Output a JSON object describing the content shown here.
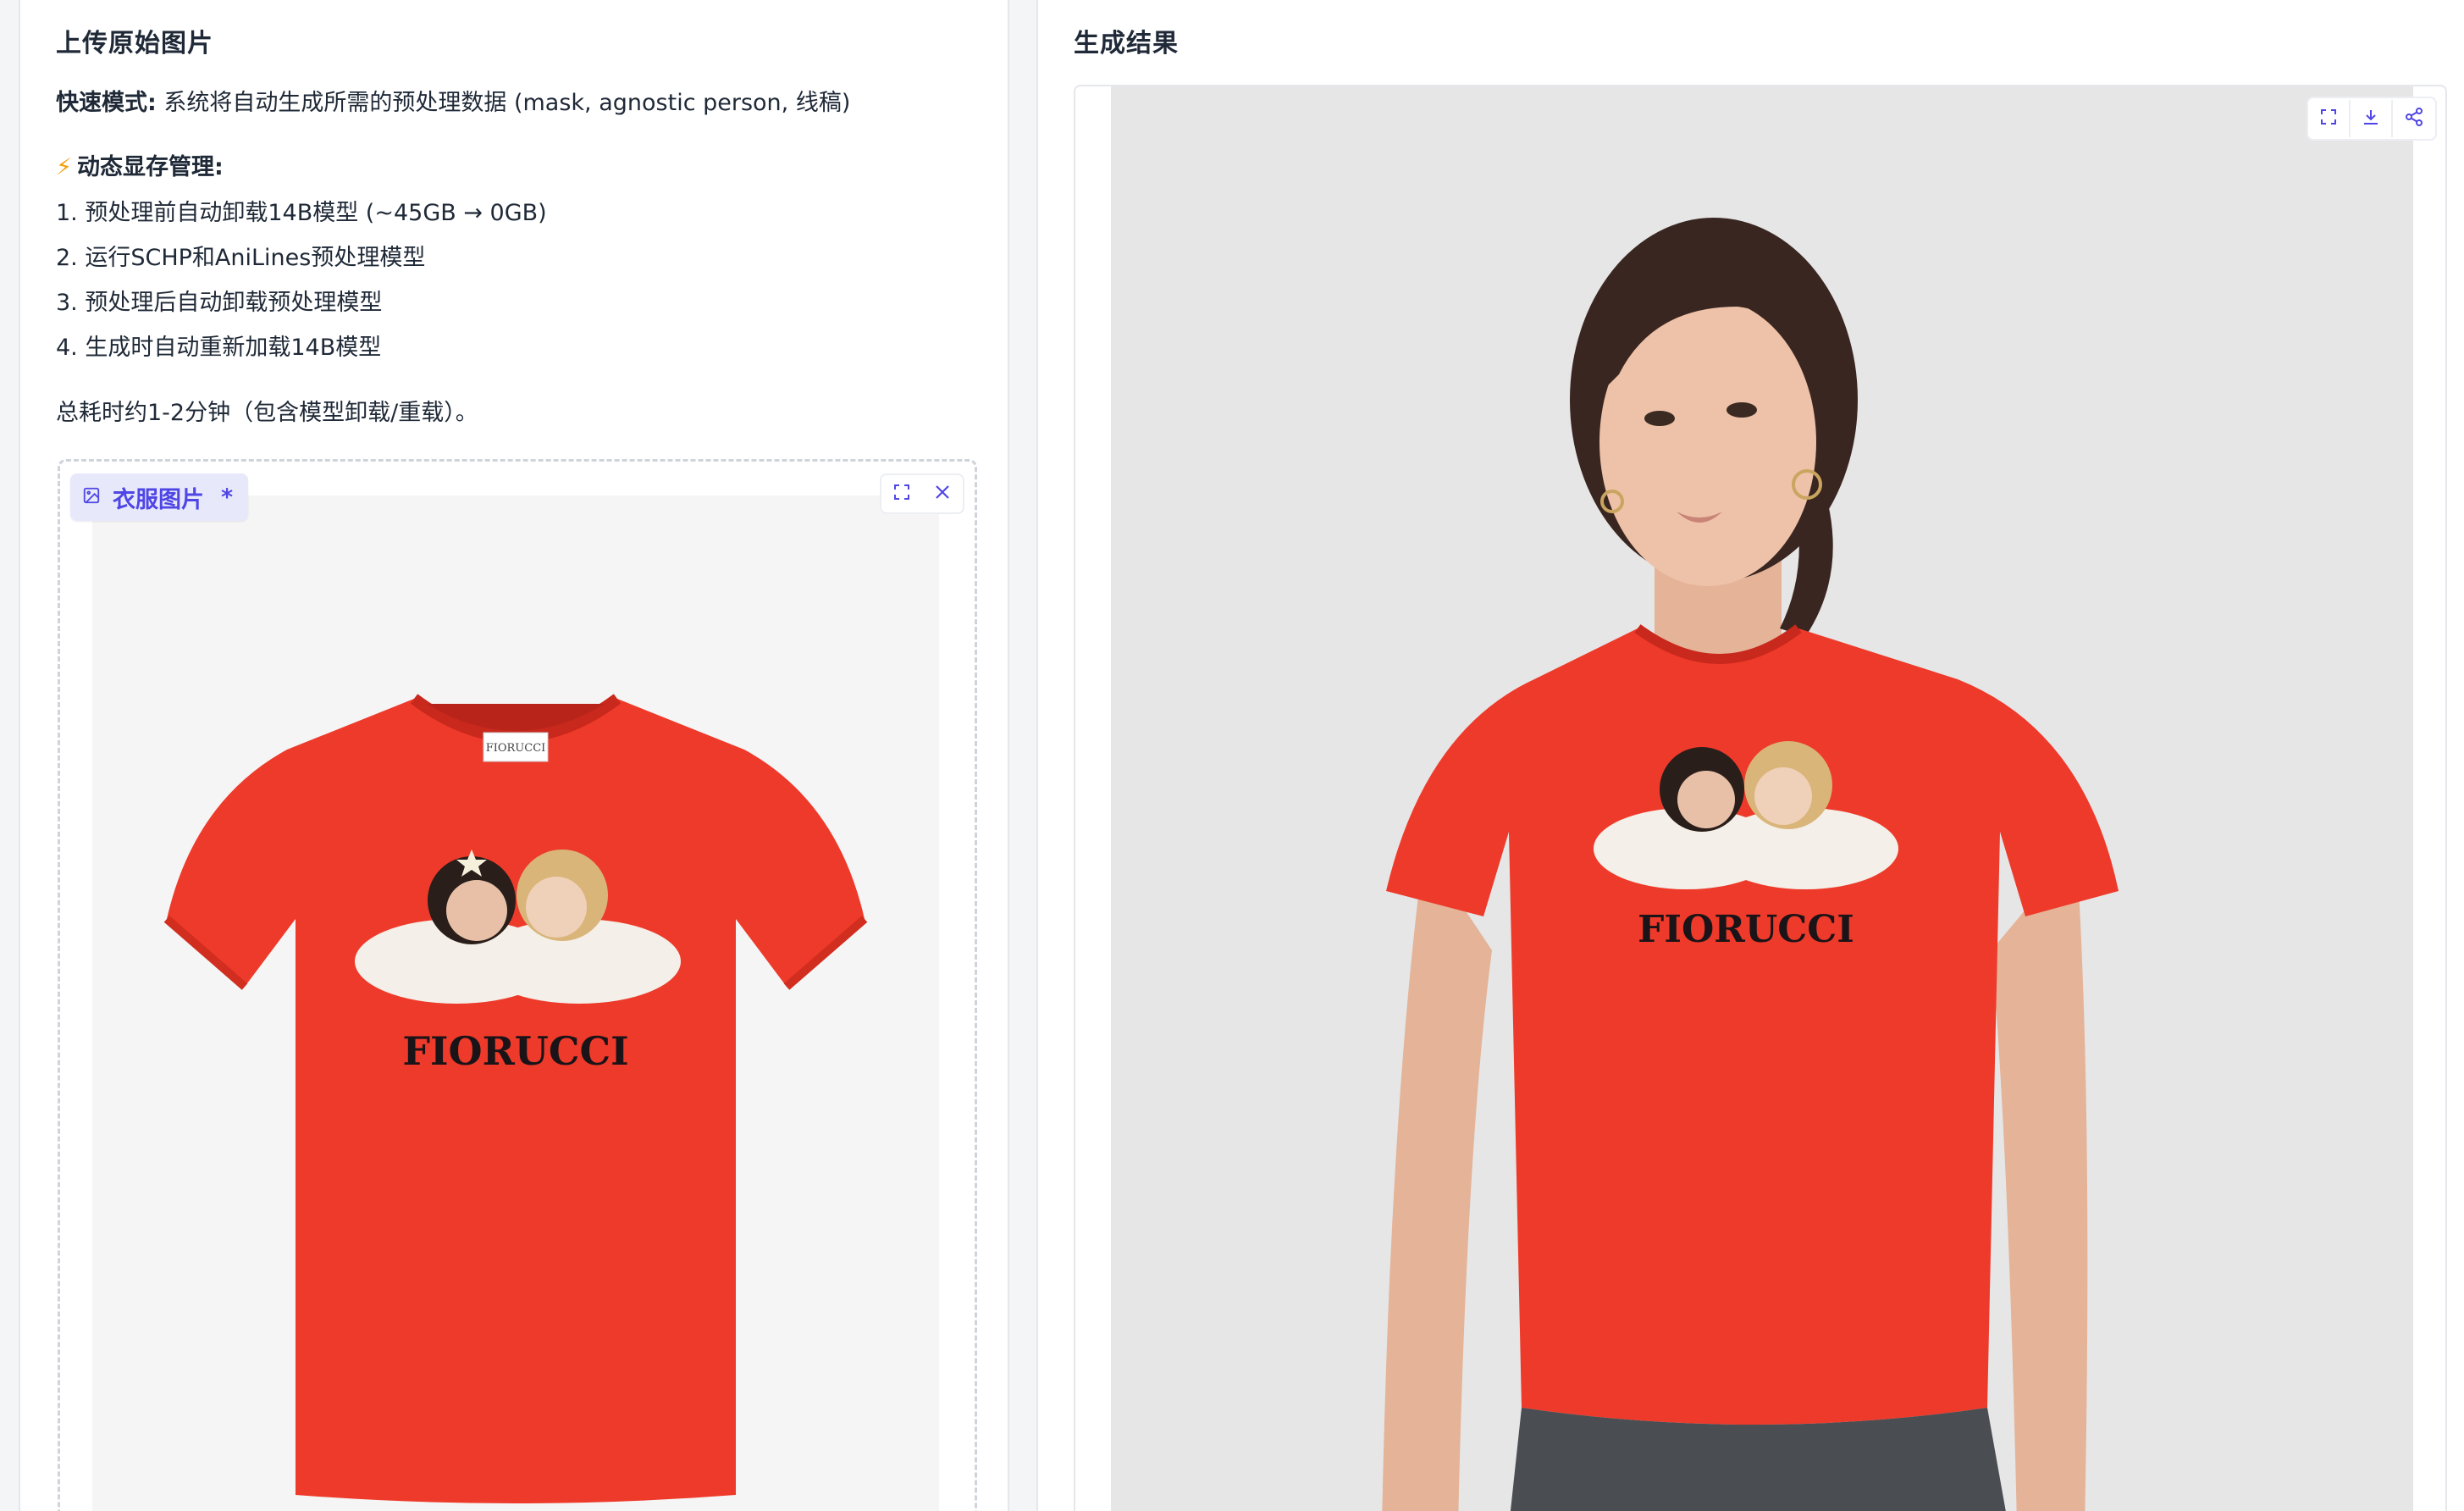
{
  "left_panel": {
    "title": "上传原始图片",
    "fast_mode_label": "快速模式:",
    "fast_mode_text": " 系统将自动生成所需的预处理数据 (mask, agnostic person, 线稿)",
    "vram_icon": "⚡",
    "vram_label": "动态显存管理:",
    "steps": [
      "1. 预处理前自动卸载14B模型 (~45GB → 0GB)",
      "2. 运行SCHP和AniLines预处理模型",
      "3. 预处理后自动卸载预处理模型",
      "4. 生成时自动重新加载14B模型"
    ],
    "time_note": "总耗时约1-2分钟（包含模型卸载/重载）。",
    "upload": {
      "label": "衣服图片",
      "required_mark": "*",
      "image_alt": "FIORUCCI red t-shirt",
      "tshirt_text": "FIORUCCI",
      "neck_tag_text": "FIORUCCI"
    }
  },
  "right_panel": {
    "title": "生成结果",
    "image_alt": "Model wearing FIORUCCI red t-shirt",
    "tshirt_text": "FIORUCCI"
  },
  "icons": {
    "image_icon": "image-icon",
    "fullscreen_icon": "fullscreen-icon",
    "close_icon": "close-icon",
    "download_icon": "download-icon",
    "share_icon": "share-icon"
  },
  "colors": {
    "accent": "#4f46e5",
    "shirt": "#ee3a2a",
    "bolt": "#f59e0b"
  }
}
